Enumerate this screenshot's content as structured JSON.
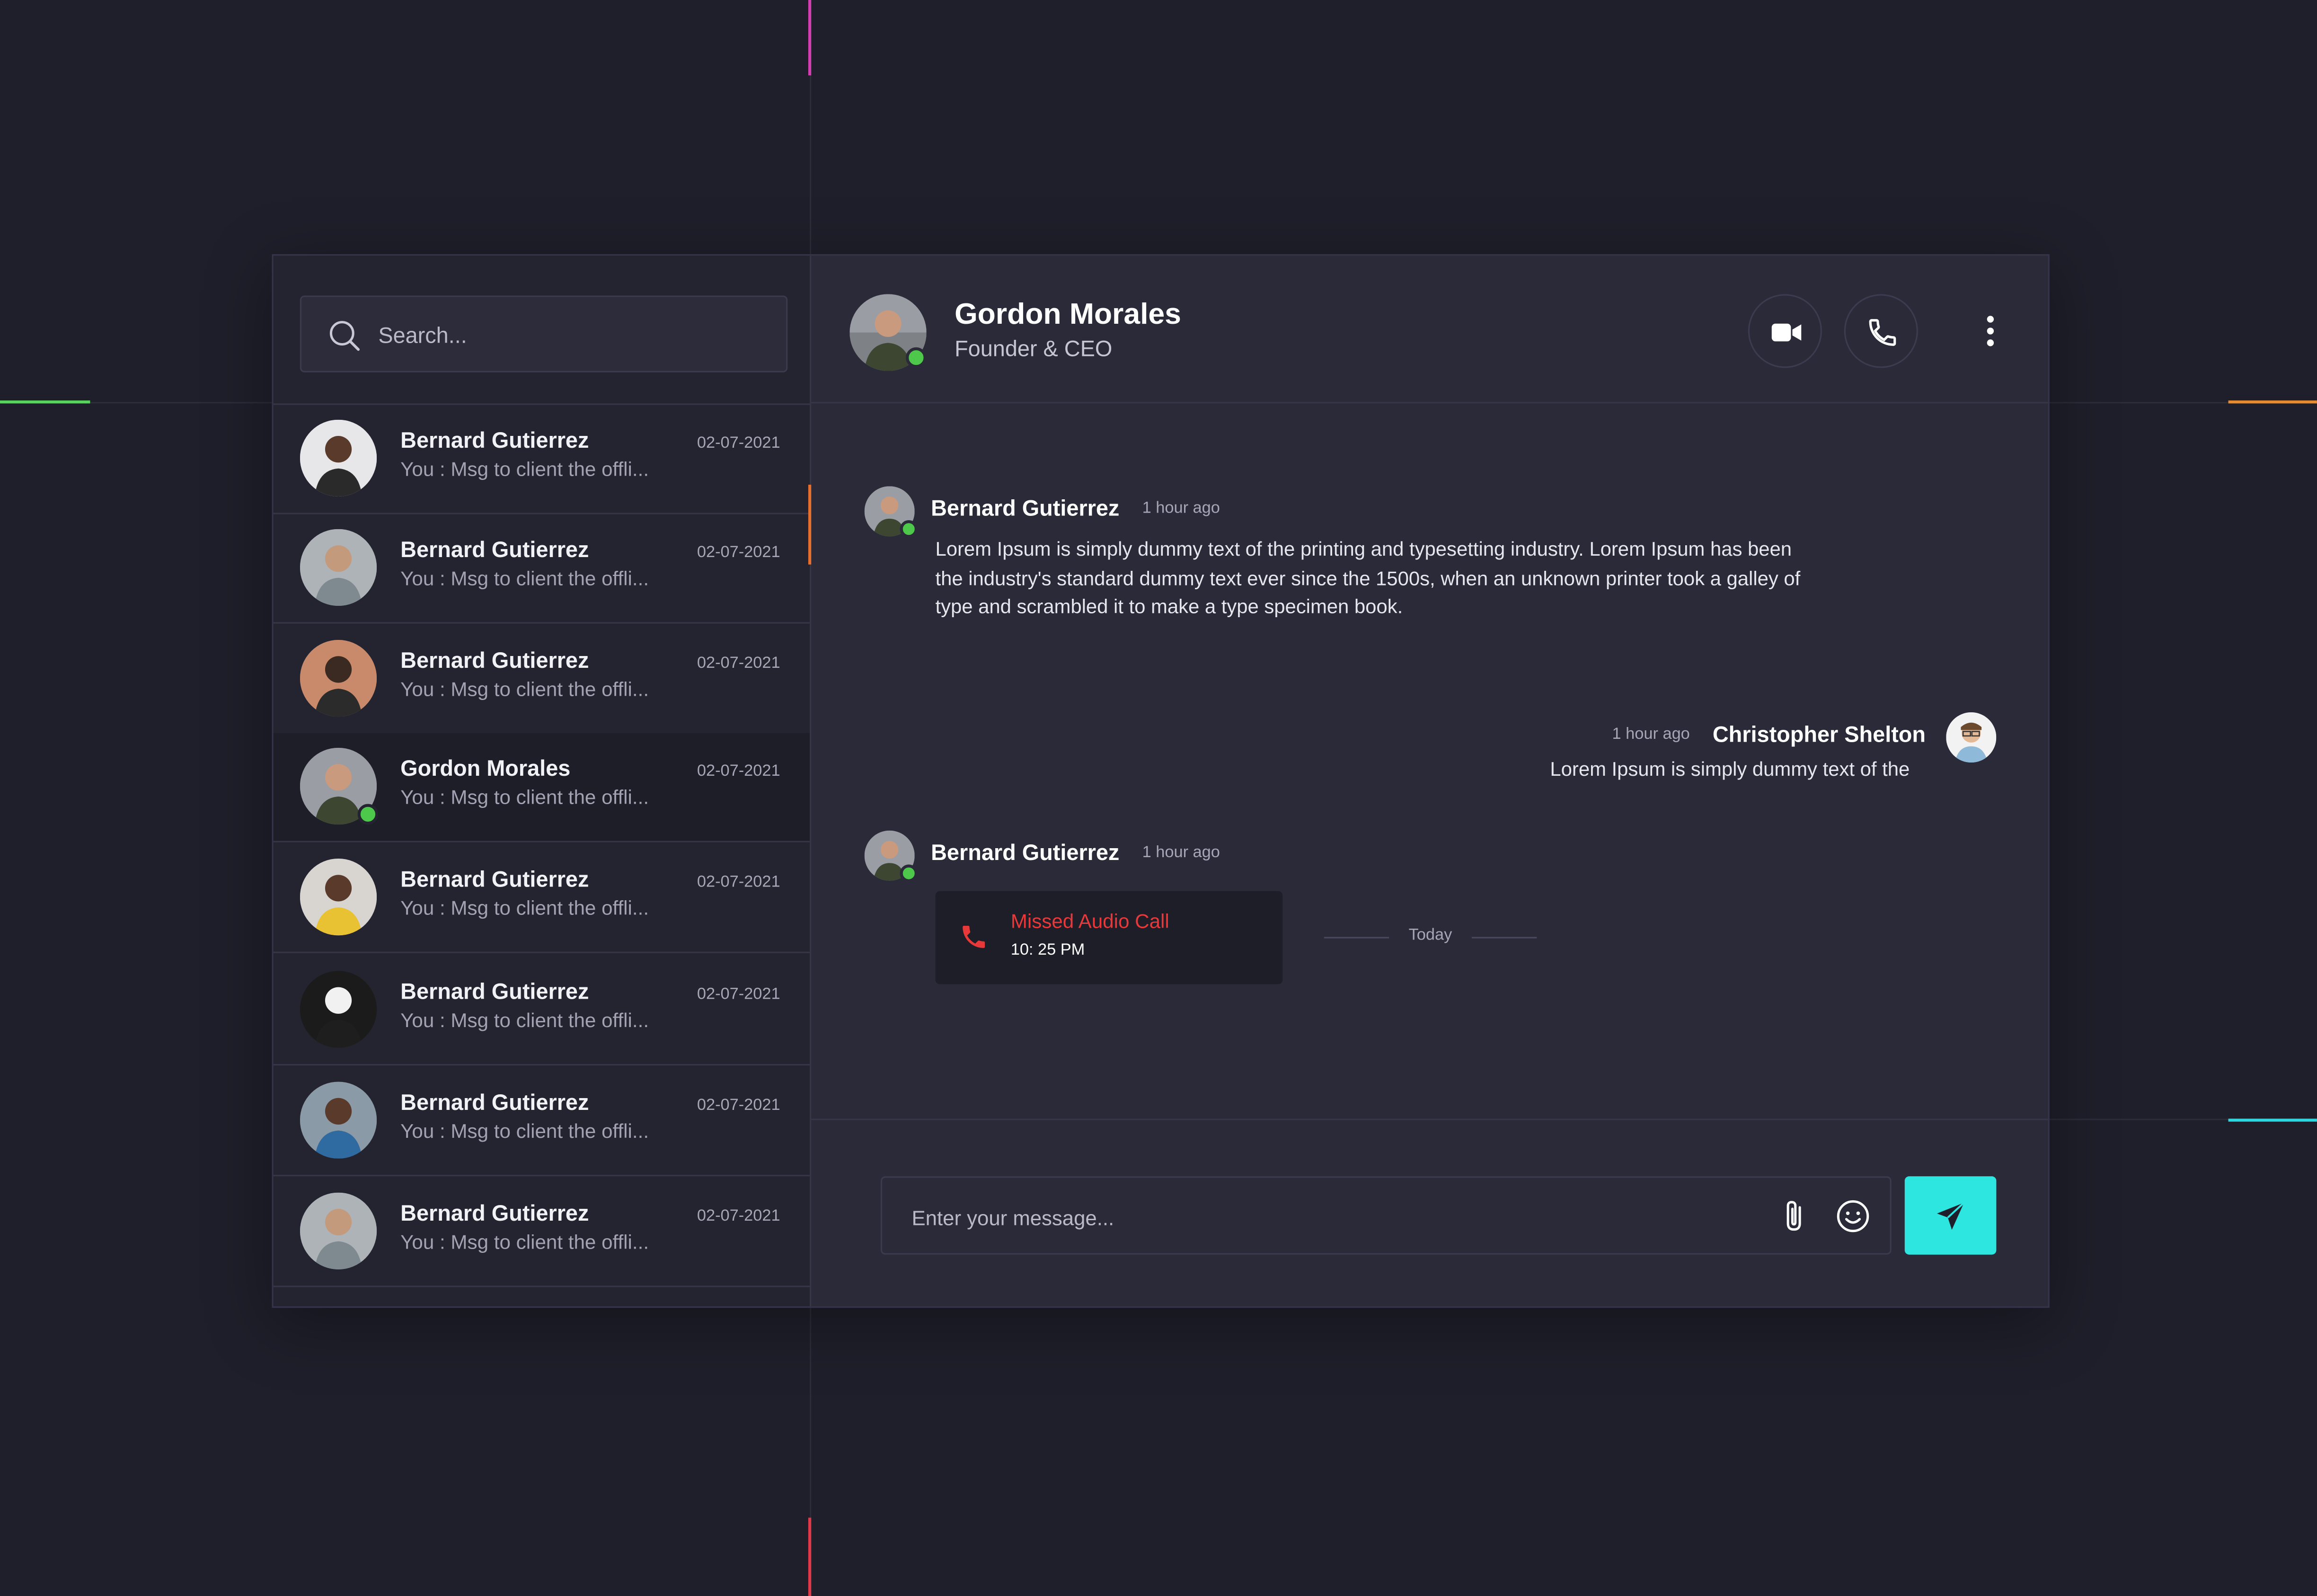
{
  "search": {
    "placeholder": "Search..."
  },
  "contacts": [
    {
      "name": "Bernard Gutierrez",
      "preview": "You : Msg to client the offli...",
      "date": "02-07-2021"
    },
    {
      "name": "Bernard Gutierrez",
      "preview": "You : Msg to client the offli...",
      "date": "02-07-2021"
    },
    {
      "name": "Bernard Gutierrez",
      "preview": "You : Msg to client the offli...",
      "date": "02-07-2021"
    },
    {
      "name": "Gordon Morales",
      "preview": "You : Msg to client the offli...",
      "date": "02-07-2021",
      "active": true,
      "online": true
    },
    {
      "name": "Bernard Gutierrez",
      "preview": "You : Msg to client the offli...",
      "date": "02-07-2021"
    },
    {
      "name": "Bernard Gutierrez",
      "preview": "You : Msg to client the offli...",
      "date": "02-07-2021"
    },
    {
      "name": "Bernard Gutierrez",
      "preview": "You : Msg to client the offli...",
      "date": "02-07-2021"
    },
    {
      "name": "Bernard Gutierrez",
      "preview": "You : Msg to client the offli...",
      "date": "02-07-2021"
    }
  ],
  "header": {
    "name": "Gordon Morales",
    "role": "Founder & CEO"
  },
  "messages": {
    "first": {
      "sender": "Bernard Gutierrez",
      "time": "1 hour ago",
      "text": "Lorem Ipsum is simply dummy text of the printing and typesetting industry. Lorem Ipsum has been the industry's standard dummy text ever since the 1500s, when an unknown printer took a galley of type and scrambled it to make a type specimen book."
    },
    "day_separator": "Today",
    "second": {
      "sender": "Christopher Shelton",
      "time": "1 hour ago",
      "text": "Lorem Ipsum is simply dummy text of the"
    },
    "third": {
      "sender": "Bernard Gutierrez",
      "time": "1 hour ago",
      "call_label": "Missed Audio Call",
      "call_time": "10: 25 PM"
    }
  },
  "composer": {
    "placeholder": "Enter your message..."
  },
  "colors": {
    "background": "#1f1f2b",
    "panel": "#2a2a38",
    "sidebar": "#242431",
    "online": "#4ec84a",
    "send_button": "#2ee6e0",
    "missed_call": "#e8393a"
  },
  "icons": {
    "search": "search-icon",
    "video": "video-camera-icon",
    "phone": "phone-icon",
    "more": "more-vertical-icon",
    "attach": "paperclip-icon",
    "emoji": "smiley-icon",
    "send": "paper-plane-icon",
    "missed_call": "missed-call-phone-icon"
  }
}
